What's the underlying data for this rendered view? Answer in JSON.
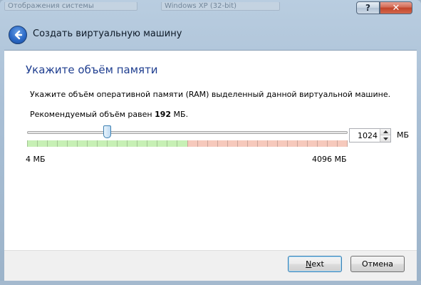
{
  "background_window": {
    "texts": [
      "Отображения системы",
      "Windows XP (32-bit)"
    ]
  },
  "window": {
    "help_label": "?",
    "close_label": "✕"
  },
  "wizard": {
    "title": "Создать виртуальную машину",
    "page_title": "Укажите объём памяти",
    "description": "Укажите объём оперативной памяти (RAM) выделенный данной виртуальной машине.",
    "recommended_prefix": "Рекомендуемый объём равен ",
    "recommended_value": "192",
    "recommended_suffix": " МБ."
  },
  "memory": {
    "slider_min_label": "4 МБ",
    "slider_max_label": "4096 МБ",
    "min_mb": 4,
    "max_mb": 4096,
    "value_mb": 1024,
    "input_value": "1024",
    "unit": "МБ",
    "green_fraction": 0.5,
    "green_color": "#c7f0b5",
    "red_color": "#f6c9bc"
  },
  "buttons": {
    "next_underlined": "N",
    "next_rest": "ext",
    "cancel": "Отмена"
  },
  "icons": {
    "back": "back-arrow-icon",
    "spin_up": "triangle-up-icon",
    "spin_down": "triangle-down-icon"
  }
}
